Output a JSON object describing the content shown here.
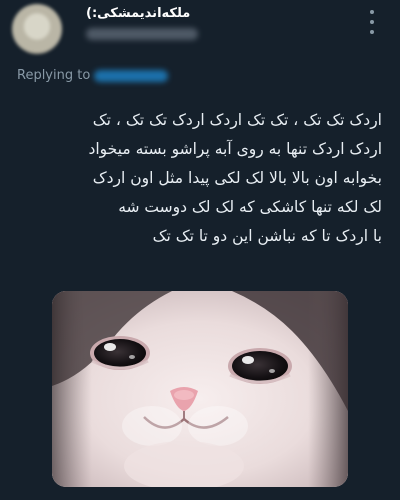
{
  "tweet": {
    "display_name": "ملکه‌اندیمشکی:)",
    "replying_label": "Replying to",
    "text_lines": [
      "اردک تک تک ، تک تک اردک اردک تک تک ، تک",
      "اردک اردک تنها به روی آبه پراشو بسته میخواد",
      "بخوابه اون بالا بالا لک لکی پیدا مثل اون اردک",
      "لک لکه تنها کاشکی که لک لک دوست شه",
      "با اردک تا که نباشن این دو تا تک تک"
    ]
  },
  "media": {
    "description_icon": "crying-cat-meme-image"
  },
  "colors": {
    "background": "#15202b",
    "text": "#e8eef3",
    "secondary": "#8899a6",
    "link": "#1d9bf0"
  }
}
